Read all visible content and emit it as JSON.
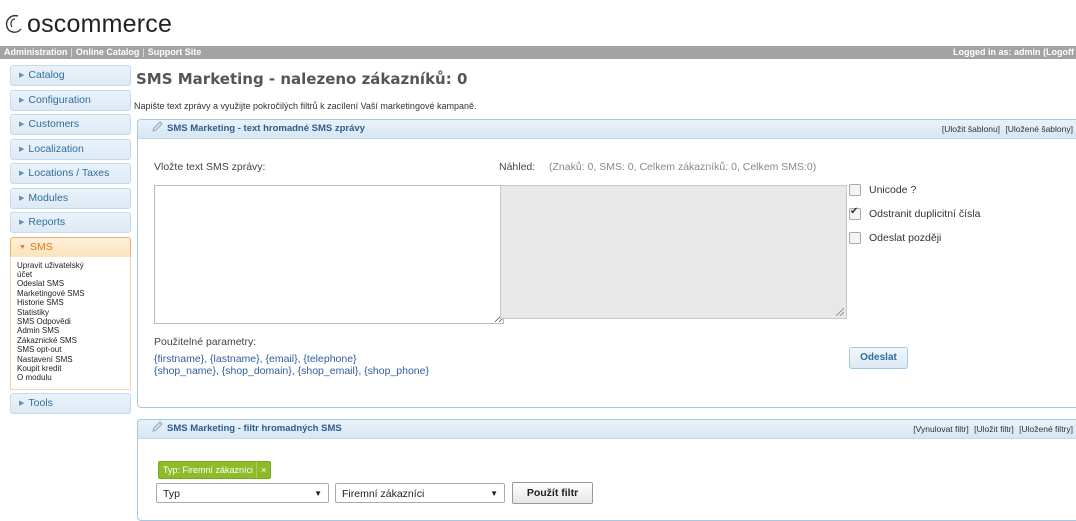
{
  "brand": {
    "name": "oscommerce"
  },
  "topbar": {
    "links": [
      "Administration",
      "Online Catalog",
      "Support Site"
    ],
    "logged_in": "Logged in as: admin (Logoff"
  },
  "sidebar": {
    "items_top": [
      {
        "label": "Catalog"
      },
      {
        "label": "Configuration"
      },
      {
        "label": "Customers"
      },
      {
        "label": "Localization"
      },
      {
        "label": "Locations / Taxes"
      },
      {
        "label": "Modules"
      },
      {
        "label": "Reports"
      }
    ],
    "open_item": {
      "label": "SMS"
    },
    "sub_items": [
      "Upravit uživatelský",
      "účet",
      "Odeslat SMS",
      "Marketingové SMS",
      "Historie SMS",
      "Statistiky",
      "SMS Odpovědi",
      "Admin SMS",
      "Zákaznické SMS",
      "SMS opt-out",
      "Nastavení SMS",
      "Koupit kredit",
      "O modulu"
    ],
    "items_bottom": [
      {
        "label": "Tools"
      }
    ]
  },
  "main": {
    "title": "SMS Marketing - nalezeno zákazníků: 0",
    "intro": "Napište text zprávy a využijte pokročilých filtrů k zacílení Vaší marketingové kampaně.",
    "compose_panel": {
      "title": "SMS Marketing - text hromadné SMS zprávy",
      "links": [
        "[Uložit šablonu]",
        "[Uložené šablony]"
      ],
      "message_label": "Vložte text SMS zprávy:",
      "message_value": "",
      "preview_label": "Náhled:",
      "preview_stats": "(Znaků: 0, SMS: 0, Celkem zákazníků: 0, Celkem SMS:0)",
      "options": [
        {
          "label": "Unicode ?",
          "checked": false
        },
        {
          "label": "Odstranit duplicitní čísla",
          "checked": true
        },
        {
          "label": "Odeslat později",
          "checked": false
        }
      ],
      "params_label": "Použitelné parametry:",
      "params_line1": "{firstname}, {lastname}, {email}, {telephone}",
      "params_line2": "{shop_name}, {shop_domain}, {shop_email}, {shop_phone}",
      "send_button": "Odeslat"
    },
    "filter_panel": {
      "title": "SMS Marketing - filtr hromadných SMS",
      "links": [
        "[Vynulovat filtr]",
        "[Uložit filtr]",
        "[Uložené filtry]"
      ],
      "active_tag": "Typ: Firemní zákazníci",
      "tag_remove": "×",
      "select_field": "Typ",
      "select_value": "Firemní zákazníci",
      "apply_button": "Použít filtr"
    }
  },
  "colors": {
    "topbar_bg": "#a3a3a3",
    "panel_border": "#a6c9e2",
    "panel_title": "#2e5e8e",
    "open_nav_text": "#e07c10",
    "tag_green": "#8dbb29"
  }
}
